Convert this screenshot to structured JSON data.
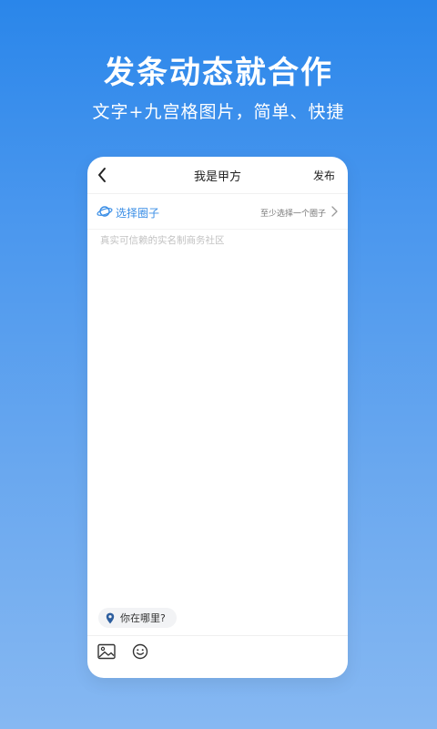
{
  "promo": {
    "headline": "发条动态就合作",
    "subheadline": "文字+九宫格图片，简单、快捷"
  },
  "nav": {
    "back_icon": "chevron-left-icon",
    "title": "我是甲方",
    "publish_label": "发布"
  },
  "circle": {
    "icon": "planet-icon",
    "label": "选择圈子",
    "hint": "至少选择一个圈子",
    "chevron_icon": "chevron-right-icon"
  },
  "editor": {
    "value": "",
    "placeholder": "真实可信赖的实名制商务社区"
  },
  "location": {
    "icon": "location-pin-icon",
    "label": "你在哪里?"
  },
  "toolbar": {
    "image_icon": "image-icon",
    "emoji_icon": "emoji-icon"
  },
  "colors": {
    "accent": "#3a8ee6",
    "background_top": "#2a86ea",
    "background_bottom": "#86b8f2",
    "pin": "#2d5e9e"
  }
}
